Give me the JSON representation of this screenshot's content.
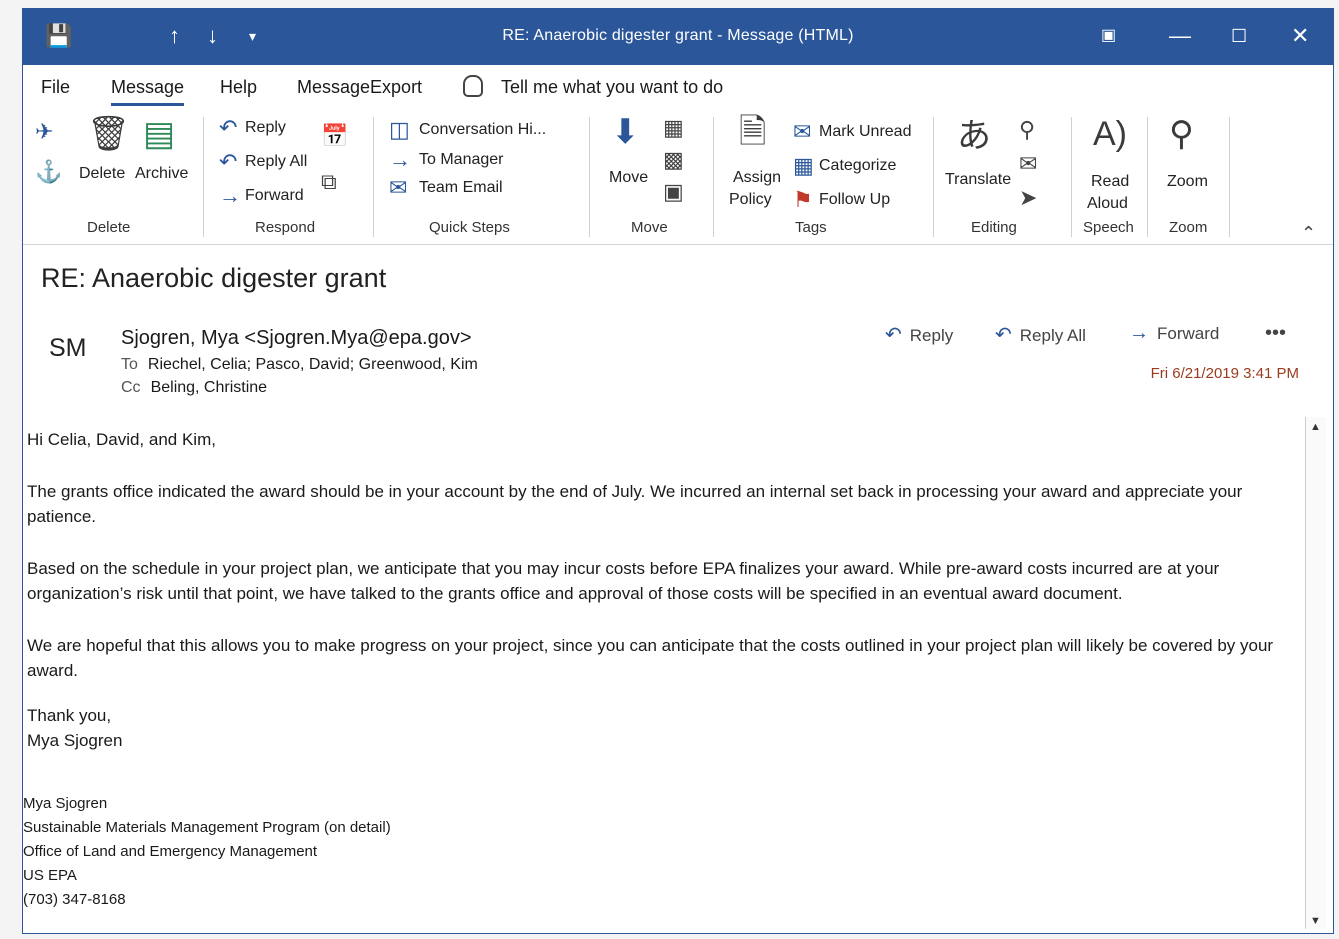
{
  "window": {
    "title": "RE: Anaerobic digester grant  -  Message (HTML)",
    "accent": "#2b579a"
  },
  "menu": {
    "items": [
      "File",
      "Message",
      "Help",
      "MessageExport"
    ],
    "active": "Message",
    "tell_me": "Tell me what you want to do"
  },
  "ribbon": {
    "delete_group": {
      "delete": "Delete",
      "archive": "Archive",
      "label": "Delete"
    },
    "respond_group": {
      "reply": "Reply",
      "reply_all": "Reply All",
      "forward": "Forward",
      "label": "Respond"
    },
    "quick_steps": {
      "items": [
        "Conversation Hi...",
        "To Manager",
        "Team Email"
      ],
      "label": "Quick Steps"
    },
    "move_group": {
      "move": "Move",
      "label": "Move"
    },
    "tags_group": {
      "assign_policy_1": "Assign",
      "assign_policy_2": "Policy",
      "mark_unread": "Mark Unread",
      "categorize": "Categorize",
      "follow_up": "Follow Up",
      "label": "Tags"
    },
    "editing_group": {
      "translate": "Translate",
      "label": "Editing"
    },
    "speech_group": {
      "read_aloud_1": "Read",
      "read_aloud_2": "Aloud",
      "label": "Speech"
    },
    "zoom_group": {
      "zoom": "Zoom",
      "label": "Zoom"
    }
  },
  "message": {
    "subject": "RE: Anaerobic digester grant",
    "avatar_initials": "SM",
    "from": "Sjogren, Mya <Sjogren.Mya@epa.gov>",
    "to_label": "To",
    "to": "Riechel, Celia; Pasco, David; Greenwood, Kim",
    "cc_label": "Cc",
    "cc": "Beling, Christine",
    "actions": {
      "reply": "Reply",
      "reply_all": "Reply All",
      "forward": "Forward",
      "more": "•••"
    },
    "date": "Fri 6/21/2019 3:41 PM",
    "body": [
      "Hi Celia, David, and Kim,",
      "The grants office indicated the award should be in your account by the end of July.  We incurred an internal set back in processing your award and appreciate your patience.",
      "Based on the schedule in your project plan, we anticipate that you may incur costs before EPA finalizes your award.  While pre-award costs incurred are at your organization’s risk until that point, we have talked to the grants office and approval of those costs will be specified in an eventual award document.",
      "We are hopeful that this allows you to make progress on your project, since you can anticipate that the costs outlined in your project plan will likely be covered by your award."
    ],
    "closing": "Thank you,",
    "closing_name": "Mya Sjogren",
    "signature": [
      "Mya Sjogren",
      "Sustainable Materials Management Program (on detail)",
      "Office of Land and Emergency Management",
      "US EPA",
      "(703) 347-8168"
    ]
  }
}
